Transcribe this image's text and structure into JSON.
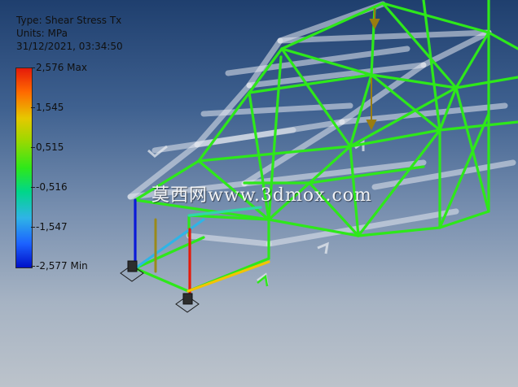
{
  "info": {
    "type_line": "Type: Shear Stress Tx",
    "units_line": "Units: MPa",
    "datetime_line": "31/12/2021, 03:34:50"
  },
  "legend": {
    "ticks": [
      "2,576 Max",
      "1,545",
      "0,515",
      "-0,516",
      "-1,547",
      "-2,577 Min"
    ],
    "max_value": 2.576,
    "min_value": -2.577
  },
  "watermark": {
    "text": "莫西网www.3dmox.com"
  },
  "colors": {
    "frame_dominant": "#2ee81a",
    "high_stress": "#e51a0a",
    "mid_high": "#e6c800",
    "low_stress": "#0010c8",
    "mid_low": "#2fb4e6",
    "undeformed_ghost": "#d8dde6",
    "background_top": "#1f3f6e",
    "background_bottom": "#bcc3cb"
  }
}
